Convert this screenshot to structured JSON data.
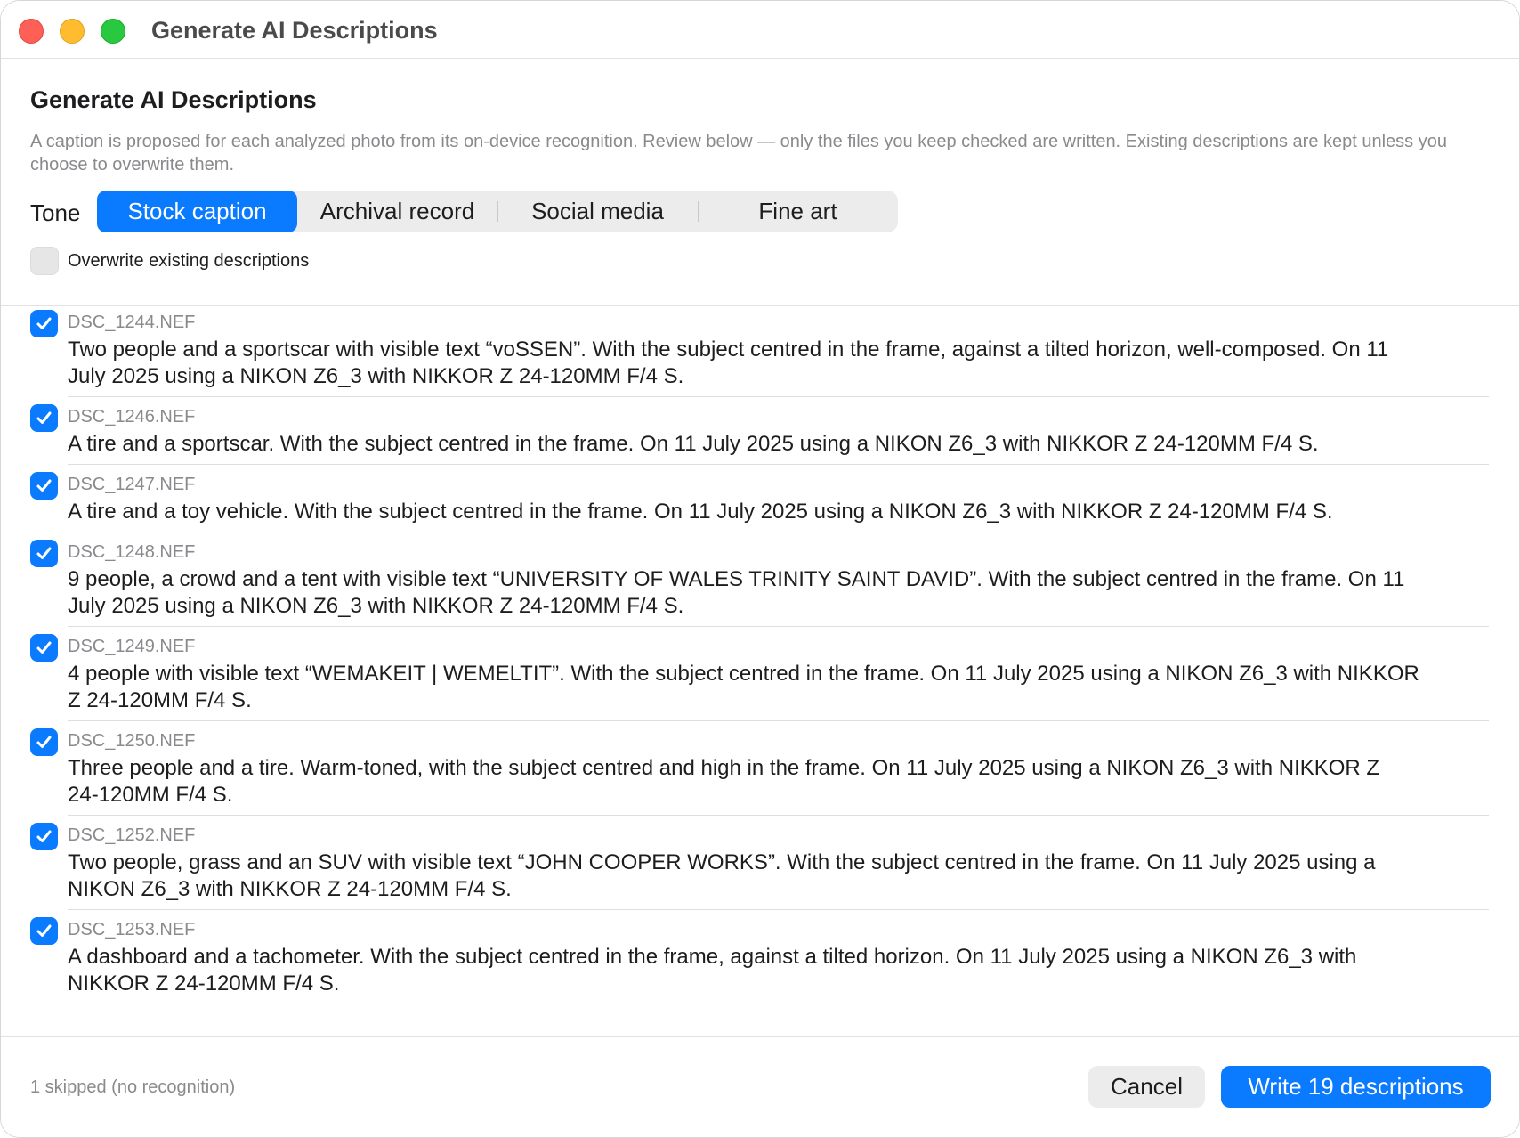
{
  "window": {
    "title": "Generate AI Descriptions"
  },
  "header": {
    "title": "Generate AI Descriptions",
    "subtitle": "A caption is proposed for each analyzed photo from its on-device recognition. Review below — only the files you keep checked are written. Existing descriptions are kept unless you choose to overwrite them."
  },
  "tone": {
    "label": "Tone",
    "options": [
      "Stock caption",
      "Archival record",
      "Social media",
      "Fine art"
    ],
    "selected": "Stock caption"
  },
  "overwrite": {
    "label": "Overwrite existing descriptions",
    "checked": false
  },
  "items": [
    {
      "file": "DSC_1244.NEF",
      "checked": true,
      "lines": [
        "Two people and a sportscar with visible text “voSSEN”. With the subject centred in the frame, against a tilted horizon, well-composed. On 11",
        "July 2025 using a NIKON Z6_3 with NIKKOR Z 24-120MM F/4 S."
      ]
    },
    {
      "file": "DSC_1246.NEF",
      "checked": true,
      "lines": [
        "A tire and a sportscar. With the subject centred in the frame. On 11 July 2025 using a NIKON Z6_3 with NIKKOR Z 24-120MM F/4 S."
      ]
    },
    {
      "file": "DSC_1247.NEF",
      "checked": true,
      "lines": [
        "A tire and a toy vehicle. With the subject centred in the frame. On 11 July 2025 using a NIKON Z6_3 with NIKKOR Z 24-120MM F/4 S."
      ]
    },
    {
      "file": "DSC_1248.NEF",
      "checked": true,
      "lines": [
        "9 people, a crowd and a tent with visible text “UNIVERSITY OF WALES TRINITY SAINT DAVID”. With the subject centred in the frame. On 11",
        "July 2025 using a NIKON Z6_3 with NIKKOR Z 24-120MM F/4 S."
      ]
    },
    {
      "file": "DSC_1249.NEF",
      "checked": true,
      "lines": [
        "4 people with visible text “WEMAKEIT | WEMELTIT”. With the subject centred in the frame. On 11 July 2025 using a NIKON Z6_3 with NIKKOR",
        "Z 24-120MM F/4 S."
      ]
    },
    {
      "file": "DSC_1250.NEF",
      "checked": true,
      "lines": [
        "Three people and a tire. Warm-toned, with the subject centred and high in the frame. On 11 July 2025 using a NIKON Z6_3 with NIKKOR Z",
        "24-120MM F/4 S."
      ]
    },
    {
      "file": "DSC_1252.NEF",
      "checked": true,
      "lines": [
        "Two people, grass and an SUV with visible text “JOHN COOPER WORKS”. With the subject centred in the frame. On 11 July 2025 using a",
        "NIKON Z6_3 with NIKKOR Z 24-120MM F/4 S."
      ]
    },
    {
      "file": "DSC_1253.NEF",
      "checked": true,
      "lines": [
        "A dashboard and a tachometer. With the subject centred in the frame, against a tilted horizon. On 11 July 2025 using a NIKON Z6_3 with",
        "NIKKOR Z 24-120MM F/4 S."
      ]
    }
  ],
  "footer": {
    "status": "1 skipped (no recognition)",
    "cancel_label": "Cancel",
    "write_label": "Write 19 descriptions"
  },
  "colors": {
    "accent": "#0a7aff",
    "segment_bg": "#ececec",
    "secondary_text": "#8a8a8e"
  },
  "icons": {
    "checkbox_checked": "checkmark-icon"
  }
}
